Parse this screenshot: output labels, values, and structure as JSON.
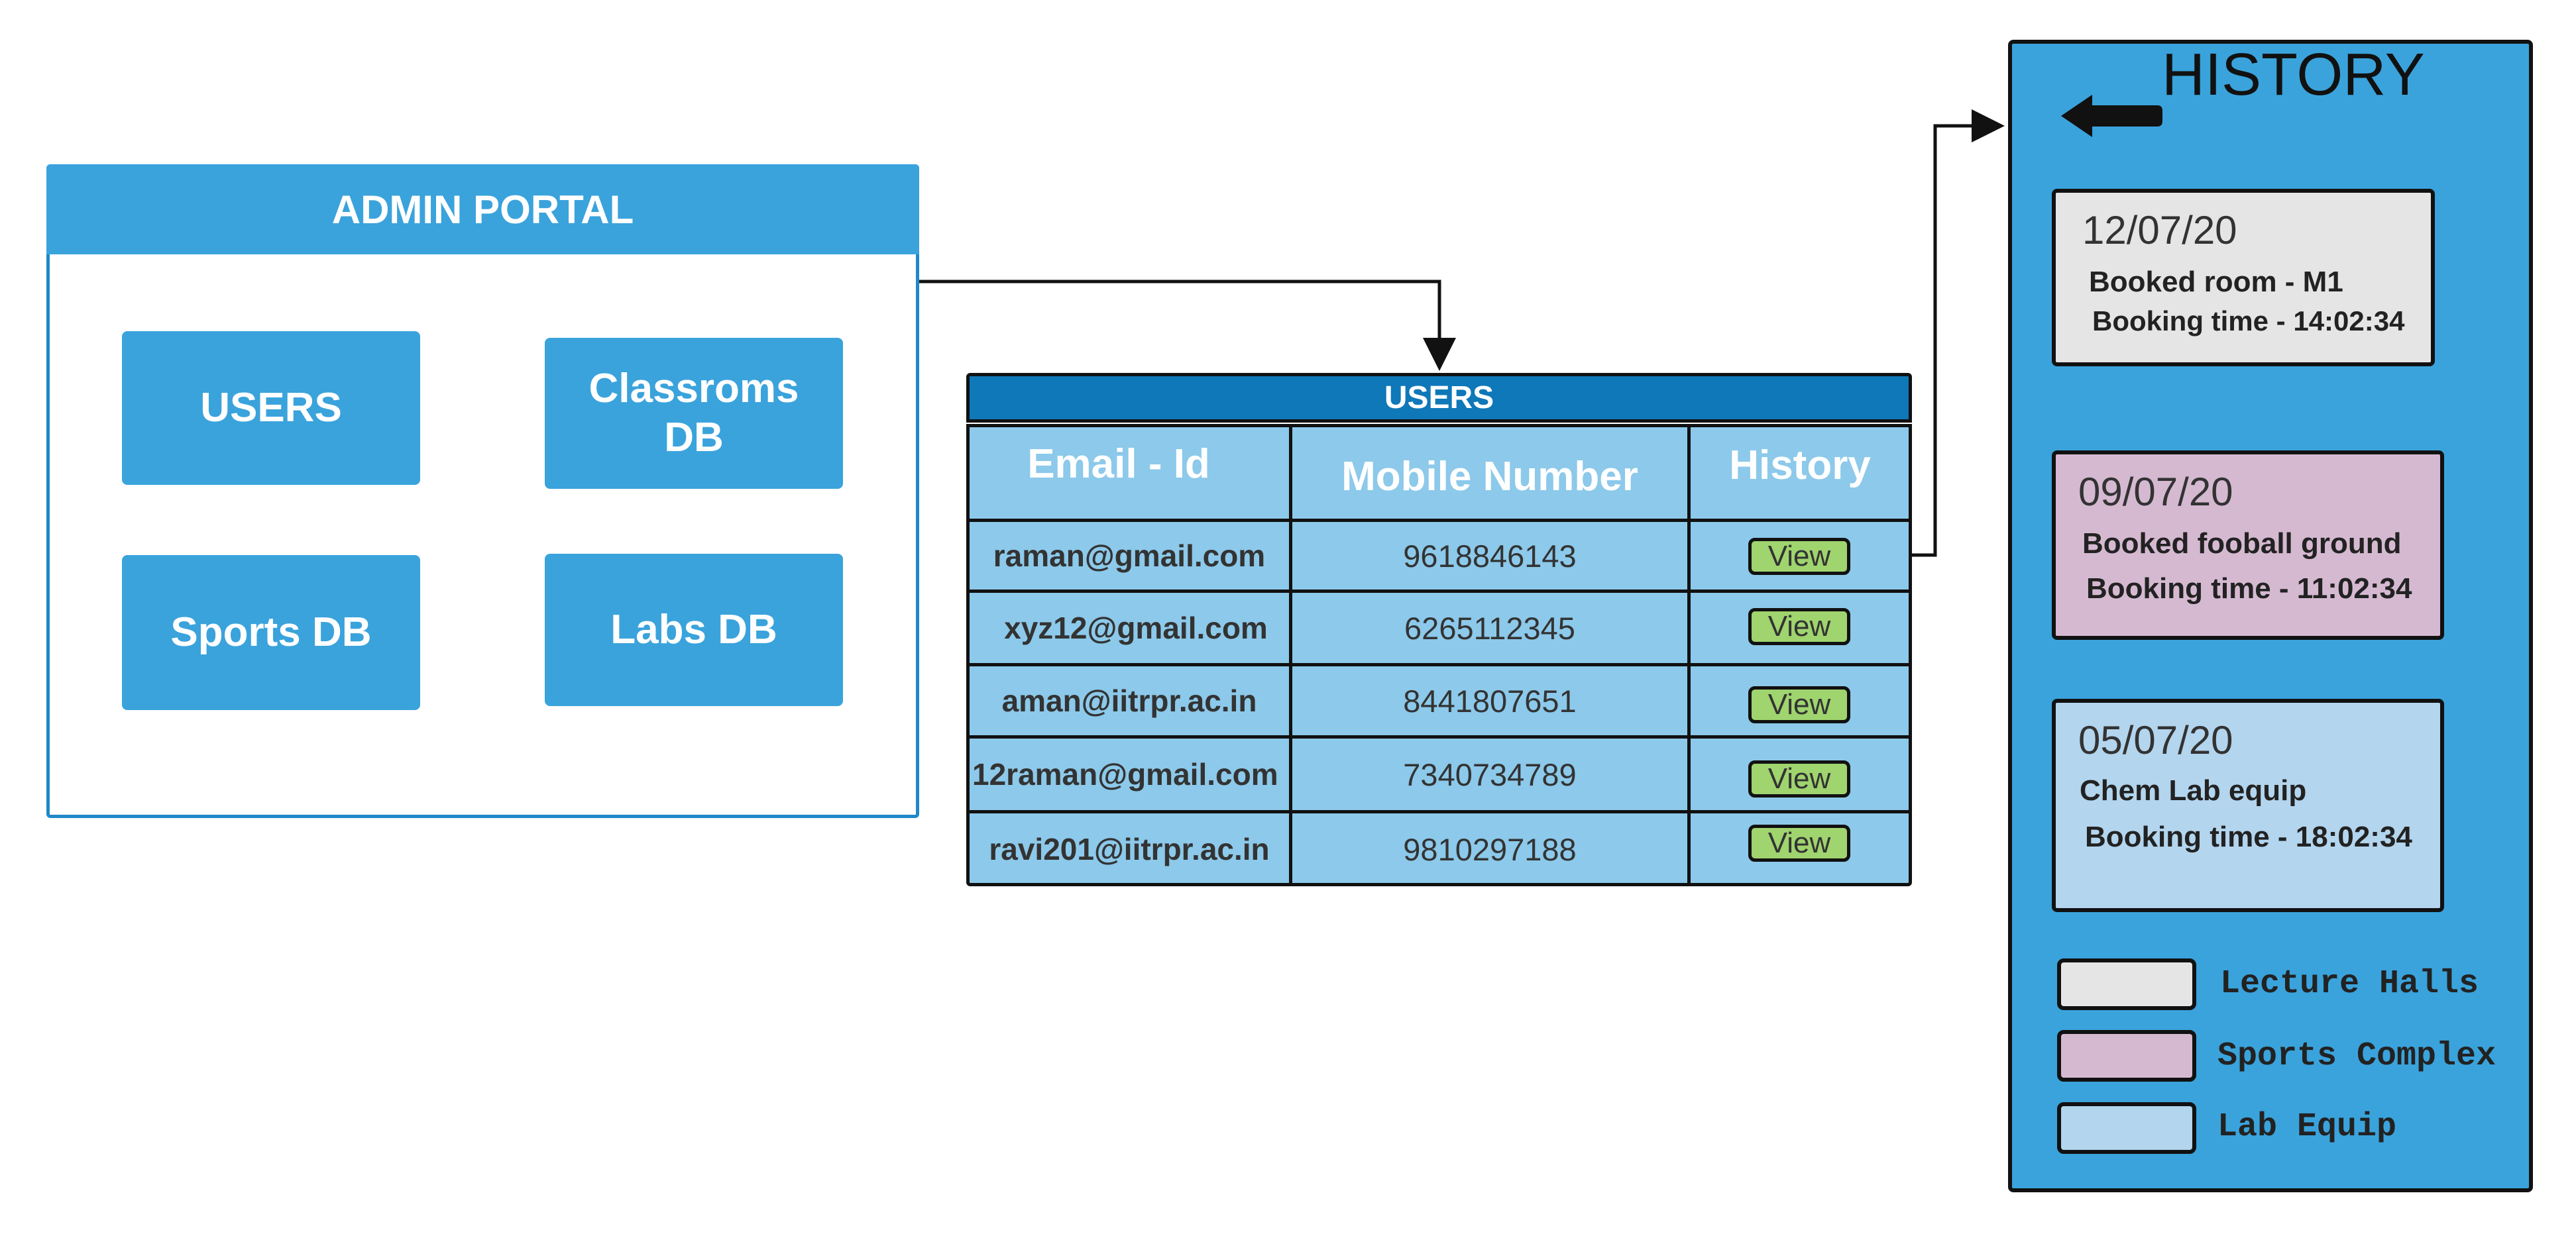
{
  "colors": {
    "portal_blue": "#3aa3dc",
    "table_header_blue": "#0e78b8",
    "table_body_blue": "#8cc9ea",
    "view_button_green": "#9fd46e",
    "lecture_halls": "#e5e5e5",
    "sports_complex": "#d5b9d1",
    "lab_equip": "#b3d5ee"
  },
  "admin_portal": {
    "title": "ADMIN PORTAL",
    "buttons": {
      "users": "USERS",
      "classrooms_line1": "Classroms",
      "classrooms_line2": "DB",
      "sports": "Sports DB",
      "labs": "Labs DB"
    }
  },
  "users_table": {
    "title": "USERS",
    "columns": [
      "Email - Id",
      "Mobile Number",
      "History"
    ],
    "rows": [
      {
        "email": "raman@gmail.com",
        "mobile": "9618846143",
        "action": "View"
      },
      {
        "email": "xyz12@gmail.com",
        "mobile": "6265112345",
        "action": "View"
      },
      {
        "email": "aman@iitrpr.ac.in",
        "mobile": "8441807651",
        "action": "View"
      },
      {
        "email": "12raman@gmail.com",
        "mobile": "7340734789",
        "action": "View"
      },
      {
        "email": "ravi201@iitrpr.ac.in",
        "mobile": "9810297188",
        "action": "View"
      }
    ]
  },
  "history": {
    "title": "HISTORY",
    "back_icon": "back-arrow-icon",
    "entries": [
      {
        "date": "12/07/20",
        "item": "Booked room - M1",
        "time": "Booking time - 14:02:34",
        "category": "lecture_halls"
      },
      {
        "date": "09/07/20",
        "item": "Booked fooball ground",
        "time": "Booking time - 11:02:34",
        "category": "sports_complex"
      },
      {
        "date": "05/07/20",
        "item": "Chem Lab equip",
        "time": "Booking time - 18:02:34",
        "category": "lab_equip"
      }
    ],
    "legend": [
      {
        "label": "Lecture Halls",
        "color": "#e5e5e5"
      },
      {
        "label": "Sports Complex",
        "color": "#d5b9d1"
      },
      {
        "label": "Lab Equip",
        "color": "#b3d5ee"
      }
    ]
  }
}
